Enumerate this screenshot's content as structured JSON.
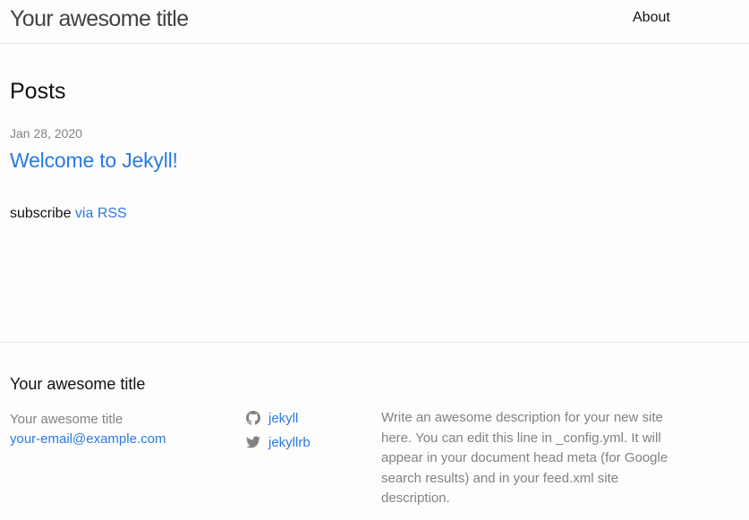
{
  "header": {
    "site_title": "Your awesome title",
    "nav": [
      {
        "label": "About"
      }
    ]
  },
  "main": {
    "heading": "Posts",
    "posts": [
      {
        "date": "Jan 28, 2020",
        "title": "Welcome to Jekyll!"
      }
    ],
    "rss": {
      "prefix": "subscribe ",
      "link_label": "via RSS"
    }
  },
  "footer": {
    "heading": "Your awesome title",
    "name": "Your awesome title",
    "email": "your-email@example.com",
    "social": [
      {
        "icon": "github-icon",
        "label": "jekyll"
      },
      {
        "icon": "twitter-icon",
        "label": "jekyllrb"
      }
    ],
    "description": "Write an awesome description for your new site here. You can edit this line in _config.yml. It will appear in your document head meta (for Google search results) and in your feed.xml site description."
  },
  "colors": {
    "link": "#2a7ae2",
    "text": "#111111",
    "muted": "#828282",
    "border": "#e8e8e8",
    "background": "#fdfdfd"
  }
}
